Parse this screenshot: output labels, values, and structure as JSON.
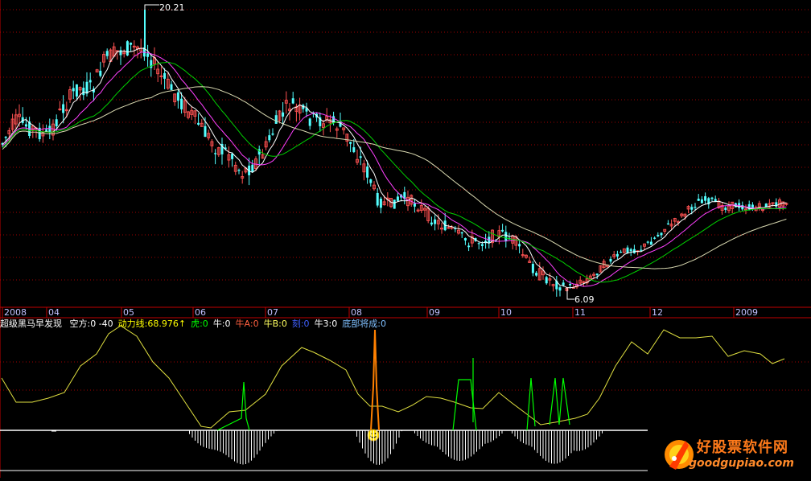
{
  "colors": {
    "background": "#000000",
    "up_candle": "#ff5252",
    "down_candle": "#54ffff",
    "ma_short": "#ffffff",
    "ma_mid": "#ff40ff",
    "ma_long": "#00d000",
    "ma_longest": "#d8d8b0",
    "indicator_line": "#e0e040",
    "bull_signal": "#00ff00",
    "spike_signal": "#ff8000",
    "grid": "#a00000",
    "axis": "#c00000"
  },
  "price_chart": {
    "high_marker": "20.21",
    "low_marker": "6.09",
    "x_axis_labels": [
      "2008",
      "04",
      "05",
      "06",
      "07",
      "08",
      "09",
      "10",
      "11",
      "12",
      "2009"
    ]
  },
  "indicator_panel": {
    "name": "超级黑马早发现",
    "items": [
      {
        "text": "空方:0 -40",
        "color": "#ffffff"
      },
      {
        "text": "动力线:68.976↑",
        "color": "#ffff00"
      },
      {
        "text": "虎:0",
        "color": "#00ff00"
      },
      {
        "text": "牛:0",
        "color": "#ffffff"
      },
      {
        "text": "牛A:0",
        "color": "#ff6040"
      },
      {
        "text": "牛B:0",
        "color": "#ffff60"
      },
      {
        "text": "刻:0",
        "color": "#4060ff"
      },
      {
        "text": "牛3:0",
        "color": "#ffffff"
      },
      {
        "text": "底部将成:0",
        "color": "#80c0ff"
      }
    ]
  },
  "watermark": {
    "brand_text": "好股票软件网",
    "url_text": "goodgupiao.com"
  },
  "chart_data": {
    "type": "candlestick",
    "period_axis": [
      "2008",
      "04",
      "05",
      "06",
      "07",
      "08",
      "09",
      "10",
      "11",
      "12",
      "2009"
    ],
    "annotations": {
      "high": 20.21,
      "low": 6.09
    },
    "indicator_name": "超级黑马早发现"
  }
}
